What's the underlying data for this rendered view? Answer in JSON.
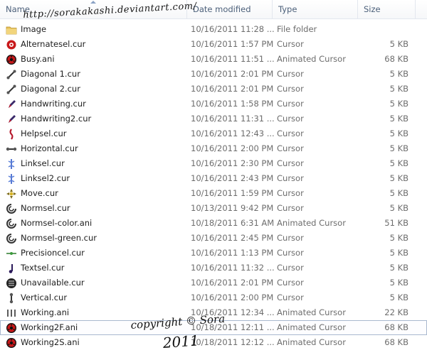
{
  "columns": {
    "name": "Name",
    "date": "Date modified",
    "type": "Type",
    "size": "Size"
  },
  "watermark": {
    "url": "http://sorakakashi.deviantart.com/",
    "copyright": "copyright © Sora",
    "year": "2011"
  },
  "files": [
    {
      "name": "Image",
      "date": "10/16/2011 11:28 ...",
      "type": "File folder",
      "size": "",
      "icon": "folder-icon"
    },
    {
      "name": "Alternatesel.cur",
      "date": "10/16/2011 1:57 PM",
      "type": "Cursor",
      "size": "5 KB",
      "icon": "cursor-file-icon"
    },
    {
      "name": "Busy.ani",
      "date": "10/16/2011 11:51 ...",
      "type": "Animated Cursor",
      "size": "68 KB",
      "icon": "animated-cursor-icon"
    },
    {
      "name": "Diagonal 1.cur",
      "date": "10/16/2011 2:01 PM",
      "type": "Cursor",
      "size": "5 KB",
      "icon": "diagonal-resize-icon"
    },
    {
      "name": "Diagonal 2.cur",
      "date": "10/16/2011 2:01 PM",
      "type": "Cursor",
      "size": "5 KB",
      "icon": "diagonal-resize-icon"
    },
    {
      "name": "Handwriting.cur",
      "date": "10/16/2011 1:58 PM",
      "type": "Cursor",
      "size": "5 KB",
      "icon": "pen-cursor-icon"
    },
    {
      "name": "Handwriting2.cur",
      "date": "10/16/2011 11:31 ...",
      "type": "Cursor",
      "size": "5 KB",
      "icon": "pen-cursor-icon"
    },
    {
      "name": "Helpsel.cur",
      "date": "10/16/2011 12:43 ...",
      "type": "Cursor",
      "size": "5 KB",
      "icon": "help-cursor-icon"
    },
    {
      "name": "Horizontal.cur",
      "date": "10/16/2011 2:00 PM",
      "type": "Cursor",
      "size": "5 KB",
      "icon": "horizontal-resize-icon"
    },
    {
      "name": "Linksel.cur",
      "date": "10/16/2011 2:30 PM",
      "type": "Cursor",
      "size": "5 KB",
      "icon": "link-cursor-icon"
    },
    {
      "name": "Linksel2.cur",
      "date": "10/16/2011 2:43 PM",
      "type": "Cursor",
      "size": "5 KB",
      "icon": "link-cursor-icon"
    },
    {
      "name": "Move.cur",
      "date": "10/16/2011 1:59 PM",
      "type": "Cursor",
      "size": "5 KB",
      "icon": "move-cursor-icon"
    },
    {
      "name": "Normsel.cur",
      "date": "10/13/2011 9:42 PM",
      "type": "Cursor",
      "size": "5 KB",
      "icon": "normal-cursor-icon"
    },
    {
      "name": "Normsel-color.ani",
      "date": "10/18/2011 6:31 AM",
      "type": "Animated Cursor",
      "size": "51 KB",
      "icon": "normal-cursor-icon"
    },
    {
      "name": "Normsel-green.cur",
      "date": "10/16/2011 2:45 PM",
      "type": "Cursor",
      "size": "5 KB",
      "icon": "normal-cursor-icon"
    },
    {
      "name": "Precisioncel.cur",
      "date": "10/16/2011 1:13 PM",
      "type": "Cursor",
      "size": "5 KB",
      "icon": "precision-cursor-icon"
    },
    {
      "name": "Textsel.cur",
      "date": "10/16/2011 11:32 ...",
      "type": "Cursor",
      "size": "5 KB",
      "icon": "text-cursor-icon"
    },
    {
      "name": "Unavailable.cur",
      "date": "10/16/2011 2:01 PM",
      "type": "Cursor",
      "size": "5 KB",
      "icon": "unavailable-cursor-icon"
    },
    {
      "name": "Vertical.cur",
      "date": "10/16/2011 2:00 PM",
      "type": "Cursor",
      "size": "5 KB",
      "icon": "vertical-resize-icon"
    },
    {
      "name": "Working.ani",
      "date": "10/16/2011 12:34 ...",
      "type": "Animated Cursor",
      "size": "22 KB",
      "icon": "working-cursor-icon"
    },
    {
      "name": "Working2F.ani",
      "date": "10/18/2011 12:11 ...",
      "type": "Animated Cursor",
      "size": "68 KB",
      "icon": "animated-cursor-icon",
      "state": "focused"
    },
    {
      "name": "Working2S.ani",
      "date": "10/18/2011 12:12 ...",
      "type": "Animated Cursor",
      "size": "68 KB",
      "icon": "animated-cursor-icon"
    }
  ]
}
